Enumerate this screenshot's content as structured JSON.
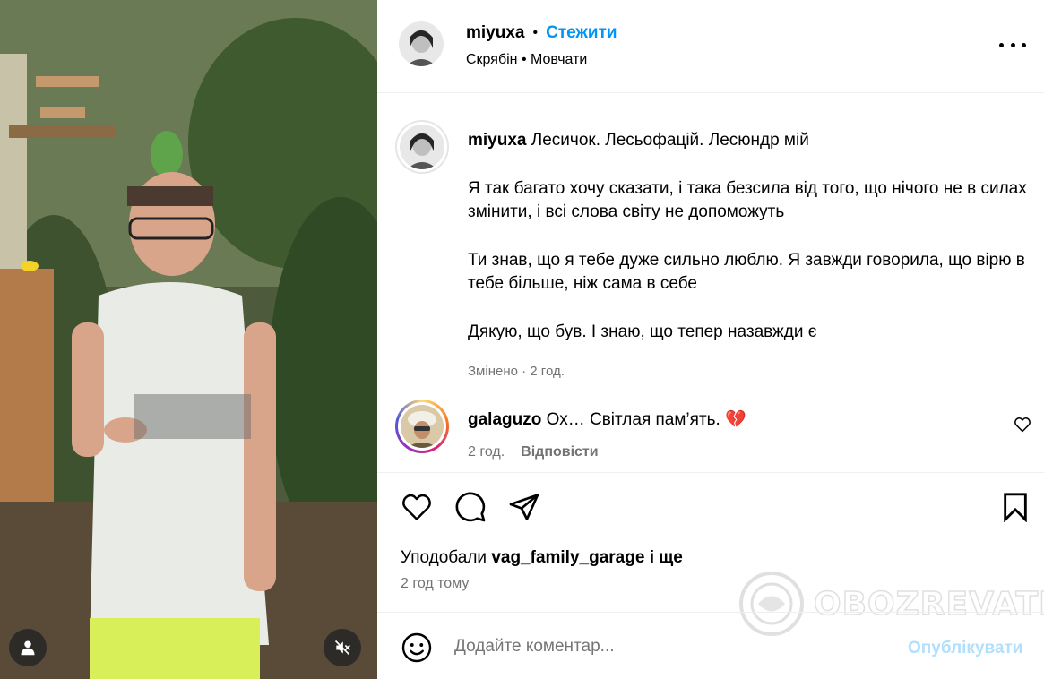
{
  "header": {
    "username": "miyuxa",
    "follow_label": "Стежити",
    "audio_artist": "Скрябін",
    "audio_title": "Мовчати",
    "more_icon": "more-horizontal-icon"
  },
  "caption": {
    "username": "miyuxa",
    "line1": "Лесичок. Лесьофацій. Лесюндр мій",
    "para2": "Я так багато хочу сказати, і така безсила від того, що нічого не в силах змінити, і всі слова світу не допоможуть",
    "para3": "Ти знав, що я тебе дуже сильно люблю. Я завжди говорила, що вірю в тебе більше, ніж сама в себе",
    "para4": "Дякую, що був. І знаю, що тепер назавжди є",
    "meta": "Змінено · 2 год."
  },
  "comment": {
    "username": "galaguzo",
    "text": "Ох… Світлая пам’ять. 💔",
    "time": "2 год.",
    "reply_label": "Відповісти"
  },
  "likes": {
    "prefix": "Уподобали",
    "user": "vag_family_garage",
    "suffix": "і ще"
  },
  "post_time": "2 год тому",
  "add_comment": {
    "placeholder": "Додайте коментар...",
    "publish_label": "Опублікувати"
  },
  "watermark": "OBOZREVATEL",
  "colors": {
    "accent": "#0095f6",
    "publish_disabled": "#b2dffc",
    "muted_text": "#737373"
  }
}
